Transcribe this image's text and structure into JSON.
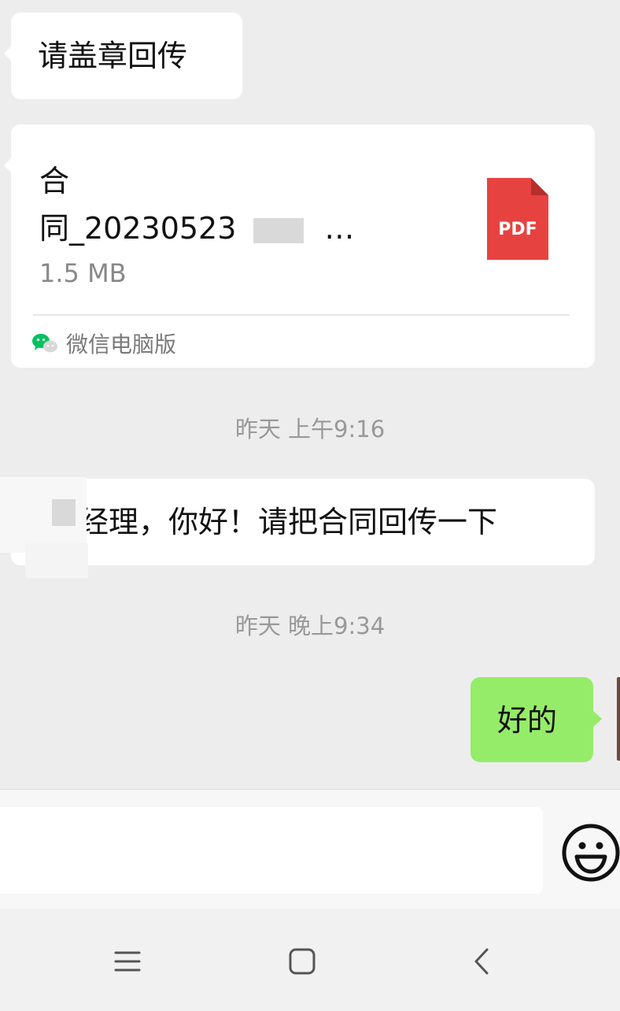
{
  "messages": {
    "msg1_text": "请盖章回传",
    "file": {
      "name_line1": "合",
      "name_line2": "同_20230523",
      "name_ellipsis": "…",
      "size": "1.5 MB",
      "source": "微信电脑版",
      "type_label": "PDF"
    },
    "time1": "昨天 上午9:16",
    "msg2_text": "经理，你好！请把合同回传一下",
    "time2": "昨天 晚上9:34",
    "reply_text": "好的"
  },
  "colors": {
    "chat_bg": "#ededed",
    "sent_bubble": "#95ec69",
    "received_bubble": "#ffffff",
    "pdf_red": "#e64340",
    "wechat_green": "#07c160"
  },
  "icons": {
    "pdf": "pdf-file-icon",
    "source": "wechat-icon",
    "emoji": "smiley-icon",
    "nav_menu": "menu-icon",
    "nav_home": "home-icon",
    "nav_back": "back-icon"
  }
}
